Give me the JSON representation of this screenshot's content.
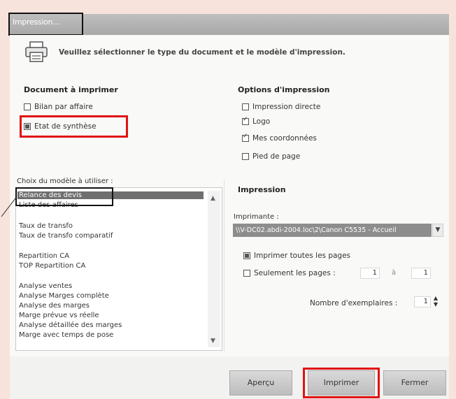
{
  "window": {
    "title": "Impression..."
  },
  "header": {
    "icon": "printer-icon",
    "instruction": "Veuillez sélectionner le type du document et le modèle d'impression."
  },
  "document": {
    "title": "Document à imprimer",
    "options": [
      {
        "label": "Bilan par affaire",
        "checked": false
      },
      {
        "label": "Etat de synthèse",
        "checked": true
      }
    ]
  },
  "print_options": {
    "title": "Options d'impression",
    "options": [
      {
        "label": "Impression directe",
        "checked": false
      },
      {
        "label": "Logo",
        "checked": true
      },
      {
        "label": "Mes coordonnées",
        "checked": true
      },
      {
        "label": "Pied de page",
        "checked": false
      }
    ]
  },
  "templates": {
    "label": "Choix du modèle à utiliser :",
    "items": [
      "Relance des devis",
      "Liste des affaires",
      "Taux de transfo",
      "Taux de transfo comparatif",
      "Repartition CA",
      "TOP Repartition CA",
      "Analyse ventes",
      "Analyse Marges complète",
      "Analyse des marges",
      "Marge prévue vs réelle",
      "Analyse détaillée des marges",
      "Marge avec temps de pose"
    ],
    "selected_index": 0
  },
  "impression": {
    "title": "Impression",
    "printer_label": "Imprimante :",
    "printer_value": "\\\\V-DC02.abdi-2004.loc\\2\\Canon C5535 - Accueil",
    "all_pages_label": "Imprimer toutes les pages",
    "only_pages_label": "Seulement les pages :",
    "page_from": "1",
    "page_to_label": "à",
    "page_to": "1",
    "copies_label": "Nombre d'exemplaires :",
    "copies": "1"
  },
  "buttons": {
    "preview": "Aperçu",
    "print": "Imprimer",
    "close": "Fermer"
  }
}
